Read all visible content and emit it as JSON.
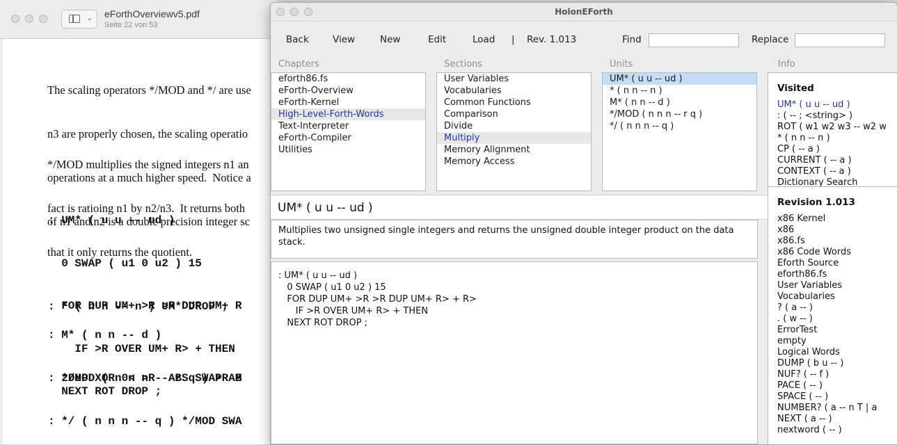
{
  "pdf": {
    "filename": "eForthOverviewv5.pdf",
    "page_info": "Seite 22 von 53",
    "prose1": [
      "The scaling operators */MOD and */ are use",
      "n3 are properly chosen, the scaling operatio",
      "operations at a much higher speed.  Notice a",
      "of n1 and n2 is a double precision integer sc"
    ],
    "prose2": [
      "*/MOD multiplies the signed integers n1 an",
      "fact is ratioing n1 by n2/n3.  It returns both",
      "that it only returns the quotient."
    ],
    "code1": [
      ": UM* ( u u -- ud )",
      "  0 SWAP ( u1 0 u2 ) 15",
      "  FOR DUP UM+ >R >R DUP UM+ R",
      "    IF >R OVER UM+ R> + THEN",
      "  NEXT ROT DROP ;"
    ],
    "code2": [
      ": * ( n n -- n ) UM* DROP ;"
    ],
    "code3": [
      ": M* ( n n -- d )",
      "  2DUP XOR 0< >R  ABS SWAP AB"
    ],
    "code4": [
      ": */MOD ( n n n -- r q ) >R M",
      ": */ ( n n n -- q ) */MOD SWA"
    ]
  },
  "holon": {
    "title": "HolonEForth",
    "toolbar": {
      "back": "Back",
      "view": "View",
      "new": "New",
      "edit": "Edit",
      "load": "Load",
      "separator": "|",
      "revision": "Rev. 1.013",
      "find_label": "Find",
      "find_value": "",
      "replace_label": "Replace",
      "replace_value": ""
    },
    "headers": {
      "chapters": "Chapters",
      "sections": "Sections",
      "units": "Units",
      "info": "Info"
    },
    "chapters": [
      "eforth86.fs",
      "eForth-Overview",
      "eForth-Kernel",
      "High-Level-Forth-Words",
      "Text-Interpreter",
      "eForth-Compiler",
      "Utilities"
    ],
    "chapters_selected": "High-Level-Forth-Words",
    "sections": [
      "User Variables",
      "Vocabularies",
      "Common Functions",
      "Comparison",
      "Divide",
      "Multiply",
      "Memory Alignment",
      "Memory Access"
    ],
    "sections_selected": "Multiply",
    "units": [
      "UM* ( u u -- ud )",
      "* ( n n -- n )",
      "M* ( n n -- d )",
      "*/MOD ( n n n -- r q )",
      "*/ ( n n n -- q )"
    ],
    "units_selected": "UM* ( u u -- ud )",
    "visited_title": "Visited",
    "visited": [
      "UM* ( u u -- ud )",
      ": ( -- ; <string> )",
      "ROT ( w1 w2 w3 -- w2 w",
      "* ( n n -- n )",
      "CP ( -- a )",
      "CURRENT ( -- a )",
      "CONTEXT ( -- a )",
      "Dictionary Search"
    ],
    "revision_title": "Revision 1.013",
    "revision_items": [
      "x86 Kernel",
      "x86",
      "x86.fs",
      "x86 Code Words",
      "Eforth Source",
      "eforth86.fs",
      "User Variables",
      "Vocabularies",
      "? ( a -- )",
      ". ( w -- )",
      "ErrorTest",
      "empty",
      "Logical Words",
      "DUMP ( b u -- )",
      "NUF? ( -- f )",
      "PACE ( -- )",
      "SPACE ( -- )",
      "NUMBER? ( a -- n T | a",
      "NEXT ( a -- )",
      "nextword ( -- )"
    ],
    "unit_title": "UM* ( u u -- ud )",
    "description": "Multiplies two unsigned single integers and returns the unsigned double integer product on the data stack.",
    "code": [
      ": UM* ( u u -- ud )",
      "   0 SWAP ( u1 0 u2 ) 15",
      "   FOR DUP UM+ >R >R DUP UM+ R> + R>",
      "      IF >R OVER UM+ R> + THEN",
      "   NEXT ROT DROP ;"
    ]
  }
}
